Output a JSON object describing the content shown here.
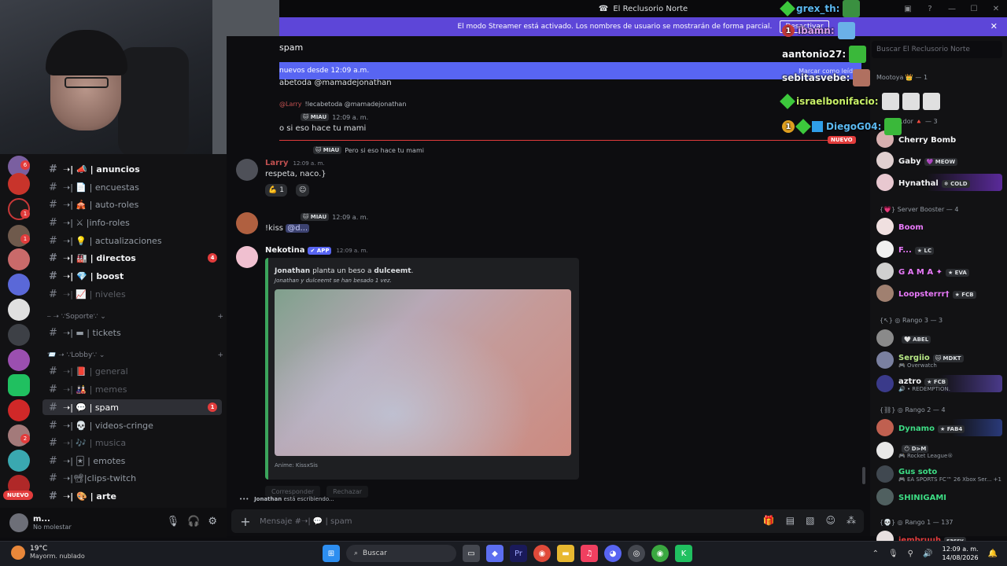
{
  "window": {
    "title": "El Reclusorio Norte",
    "controls": [
      "▣",
      "?",
      "—",
      "☐",
      "✕"
    ]
  },
  "banner": {
    "text": "El modo Streamer está activado. Los nombres de usuario se mostrarán de forma parcial.",
    "button": "Desactivar"
  },
  "server_rail": {
    "badges": [
      "6",
      "1",
      "1",
      "2"
    ],
    "nuevo": "NUEVO"
  },
  "channels": [
    {
      "name": "➝| 📣 | anuncios",
      "style": "bold"
    },
    {
      "name": "➝| 📄 | encuestas",
      "style": "normal"
    },
    {
      "name": "➝| 🎪 | auto-roles",
      "style": "normal"
    },
    {
      "name": "➝| ⚔ |info-roles",
      "style": "normal"
    },
    {
      "name": "➝| 💡 | actualizaciones",
      "style": "normal"
    },
    {
      "name": "➝| 🏭 | directos",
      "style": "bold",
      "badge": "4"
    },
    {
      "name": "➝| 💎 | boost",
      "style": "bold"
    },
    {
      "name": "➝| 📈 | niveles",
      "style": "dim"
    },
    {
      "name": "➝| ▬ | tickets",
      "style": "normal"
    },
    {
      "name": "➝| 📕 | general",
      "style": "dim"
    },
    {
      "name": "➝| 🎎 | memes",
      "style": "dim"
    },
    {
      "name": "➝| 💬 | spam",
      "style": "active",
      "badge": "1"
    },
    {
      "name": "➝| 💀 | videos-cringe",
      "style": "normal"
    },
    {
      "name": "➝| 🎶 | musica",
      "style": "dim"
    },
    {
      "name": "➝| 🃏 | emotes",
      "style": "normal"
    },
    {
      "name": "➝|📽|clips-twitch",
      "style": "normal"
    },
    {
      "name": "➝| 🎨 | arte",
      "style": "bold"
    }
  ],
  "categories": {
    "soporte": "⎯ ➝ ∵Soporte∵ ⌄",
    "lobby": "📨 ➝ ∵Lobby∵ ⌄",
    "add": "+"
  },
  "user_panel": {
    "name": "m...",
    "status": "No molestar"
  },
  "chat": {
    "channel_title": "spam",
    "new_bar": "nuevos desde 12:09 a.m.",
    "mark_read": "Marcar como leído",
    "line1": "abetoda @mamadejonathan",
    "reply1_user": "@Larry",
    "reply1_text": "!lecabetoda @mamadejonathan",
    "tag_miau": "🐱 MIAU",
    "time": "12:09 a. m.",
    "line2": "o si eso hace tu mami",
    "reply2_text": "Pero si eso hace tu mami",
    "nuevo": "NUEVO",
    "larry_name": "Larry",
    "larry_text": "respeta, naco.}",
    "reaction_count": "1",
    "kiss_text": "!kiss",
    "kiss_mention": "@d...",
    "bot_name": "Nekotina",
    "bot_badge": "✔ APP",
    "embed_line1_a": "Jonathan",
    "embed_line1_b": " planta un beso a ",
    "embed_line1_c": "dulceemt",
    "embed_line1_d": ".",
    "embed_line2": "Jonathan y dulceemt se han besado 1 vez.",
    "embed_footer": "Anime: KissxSis",
    "btn_corresponder": "Corresponder",
    "btn_rechazar": "Rechazar",
    "typing_name": "Jonathan",
    "typing_rest": " está escribiendo...",
    "composer_placeholder": "Mensaje #➝| 💬 | spam"
  },
  "members": {
    "search": "Buscar El Reclusorio Norte",
    "top_list": [
      {
        "name": "Mootoya 👑",
        "extra": "— 1"
      },
      {
        "name": "...dor 🔺",
        "extra": "— 3"
      }
    ],
    "list1": [
      {
        "name": "Cherry Bomb",
        "color": "#f2f3f5"
      },
      {
        "name": "Gaby",
        "tag": "💜 MEOW",
        "color": "#f2f3f5"
      },
      {
        "name": "Hynathal",
        "tag": "❄ COLD",
        "color": "#f2f3f5"
      }
    ],
    "group_booster": "{💗} Server Booster — 4",
    "list2": [
      {
        "name": "Boom",
        "color": "#e879f9"
      },
      {
        "name": "F...",
        "tag": "★ LC",
        "color": "#e879f9"
      },
      {
        "name": "G A M A ✦",
        "tag": "★ EVA",
        "color": "#e879f9"
      },
      {
        "name": "Loopsterrr†",
        "tag": "★ FCB",
        "color": "#e879f9"
      }
    ],
    "group_rango3": "{↖} ◎ Rango 3 — 3",
    "list3": [
      {
        "name": "",
        "tag": "🤍 ABEL",
        "color": "#f2f3f5"
      },
      {
        "name": "Sergiio",
        "tag": "🐱 MDKT",
        "sub": "🎮 Overwatch",
        "color": "#b8e986"
      },
      {
        "name": "aztro",
        "tag": "★ FCB",
        "sub": "🔊 • REDEMPTION.",
        "color": "#f2f3f5"
      }
    ],
    "group_rango2": "{⛓} ◎ Rango 2 — 4",
    "list4": [
      {
        "name": "Dynamo",
        "tag": "★ FAB4",
        "color": "#3ddc84"
      },
      {
        "name": "",
        "tag": "😶 D⋗M",
        "sub": "🎮 Rocket League®",
        "color": "#f2f3f5"
      },
      {
        "name": "Gus soto",
        "sub": "🎮 EA SPORTS FC™ 26 Xbox Ser... +1",
        "color": "#3ddc84"
      },
      {
        "name": "SHINIGAMI",
        "color": "#3ddc84"
      }
    ],
    "group_rango1": "{💀} ◎ Rango 1 — 137",
    "last": {
      "name": "iembruuh",
      "tag": "sassy"
    }
  },
  "overlay": {
    "l1": "grex_th:",
    "l2": "ibamn:",
    "l3": "aantonio27:",
    "l4": "sebitasvebe:",
    "l5": "israelbonifacio:",
    "l6": "DiegoG04:",
    "num1": "1"
  },
  "taskbar": {
    "temp": "19°C",
    "weather": "Mayorm. nublado",
    "search": "Buscar",
    "time": "12:09 a. m.",
    "date": "14/08/2026"
  }
}
